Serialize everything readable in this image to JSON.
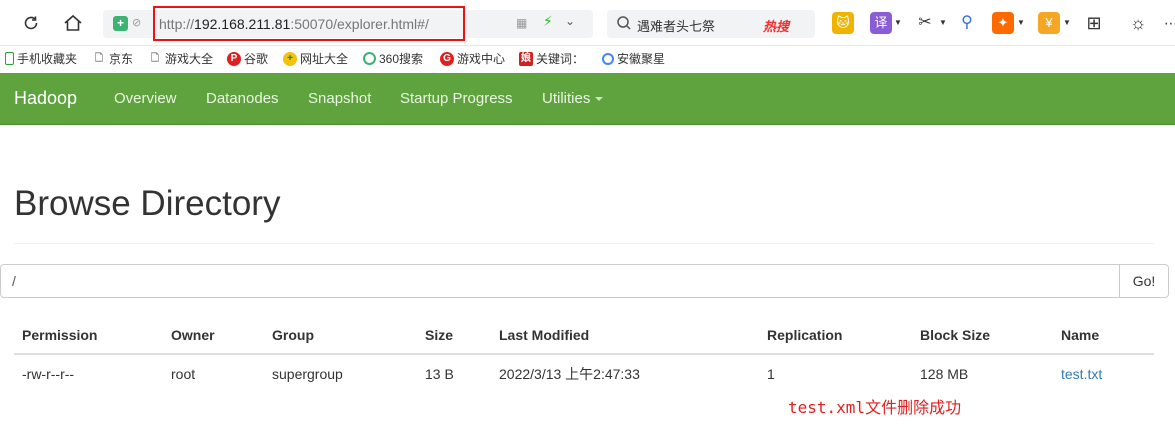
{
  "browser": {
    "url_prefix": "http://",
    "url_host": "192.168.211.81",
    "url_rest": ":50070/explorer.html#/",
    "search_text": "遇难者头七祭",
    "hot_label": "热搜",
    "ext_translate": "译",
    "ext_yen": "¥"
  },
  "bookmarks": [
    {
      "label": "手机收藏夹"
    },
    {
      "label": "京东"
    },
    {
      "label": "游戏大全"
    },
    {
      "label": "谷歌"
    },
    {
      "label": "网址大全"
    },
    {
      "label": "360搜索"
    },
    {
      "label": "游戏中心"
    },
    {
      "label": "关键词："
    },
    {
      "label": "安徽聚星"
    }
  ],
  "navbar": {
    "brand": "Hadoop",
    "items": [
      {
        "label": "Overview"
      },
      {
        "label": "Datanodes"
      },
      {
        "label": "Snapshot"
      },
      {
        "label": "Startup Progress"
      },
      {
        "label": "Utilities"
      }
    ]
  },
  "page": {
    "title": "Browse Directory",
    "path_value": "/",
    "go_label": "Go!"
  },
  "table": {
    "headers": [
      "Permission",
      "Owner",
      "Group",
      "Size",
      "Last Modified",
      "Replication",
      "Block Size",
      "Name"
    ],
    "rows": [
      [
        "-rw-r--r--",
        "root",
        "supergroup",
        "13 B",
        "2022/3/13 上午2:47:33",
        "1",
        "128 MB",
        "test.txt"
      ]
    ]
  },
  "annotation": "test.xml文件删除成功",
  "colors": {
    "navbar": "#5fa33e",
    "link": "#337ab7",
    "highlight_box": "#e11111",
    "annotation": "#e02020"
  }
}
